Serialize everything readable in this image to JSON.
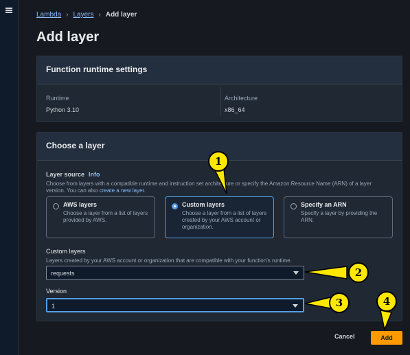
{
  "nav": {
    "menu_icon": "hamburger-icon"
  },
  "breadcrumb": {
    "items": [
      "Lambda",
      "Layers",
      "Add layer"
    ]
  },
  "page": {
    "title": "Add layer"
  },
  "runtime_panel": {
    "header": "Function runtime settings",
    "runtime_label": "Runtime",
    "runtime_value": "Python 3.10",
    "arch_label": "Architecture",
    "arch_value": "x86_64"
  },
  "layer_panel": {
    "header": "Choose a layer",
    "source_label": "Layer source",
    "info_link": "Info",
    "source_desc": "Choose from layers with a compatible runtime and instruction set architecture or specify the Amazon Resource Name (ARN) of a layer version. You can also",
    "create_link": "create a new layer",
    "create_suffix": ".",
    "options": [
      {
        "title": "AWS layers",
        "desc": "Choose a layer from a list of layers provided by AWS."
      },
      {
        "title": "Custom layers",
        "desc": "Choose a layer from a list of layers created by your AWS account or organization."
      },
      {
        "title": "Specify an ARN",
        "desc": "Specify a layer by providing the ARN."
      }
    ],
    "selected_option": "Custom layers",
    "custom_layers_label": "Custom layers",
    "custom_layers_desc": "Layers created by your AWS account or organization that are compatible with your function's runtime.",
    "custom_layers_value": "requests",
    "version_label": "Version",
    "version_value": "1"
  },
  "footer": {
    "cancel": "Cancel",
    "add": "Add"
  },
  "markers": [
    "1",
    "2",
    "3",
    "4"
  ],
  "colors": {
    "accent": "#539fe5",
    "primary_button": "#ff9900",
    "marker": "#ffe800"
  }
}
